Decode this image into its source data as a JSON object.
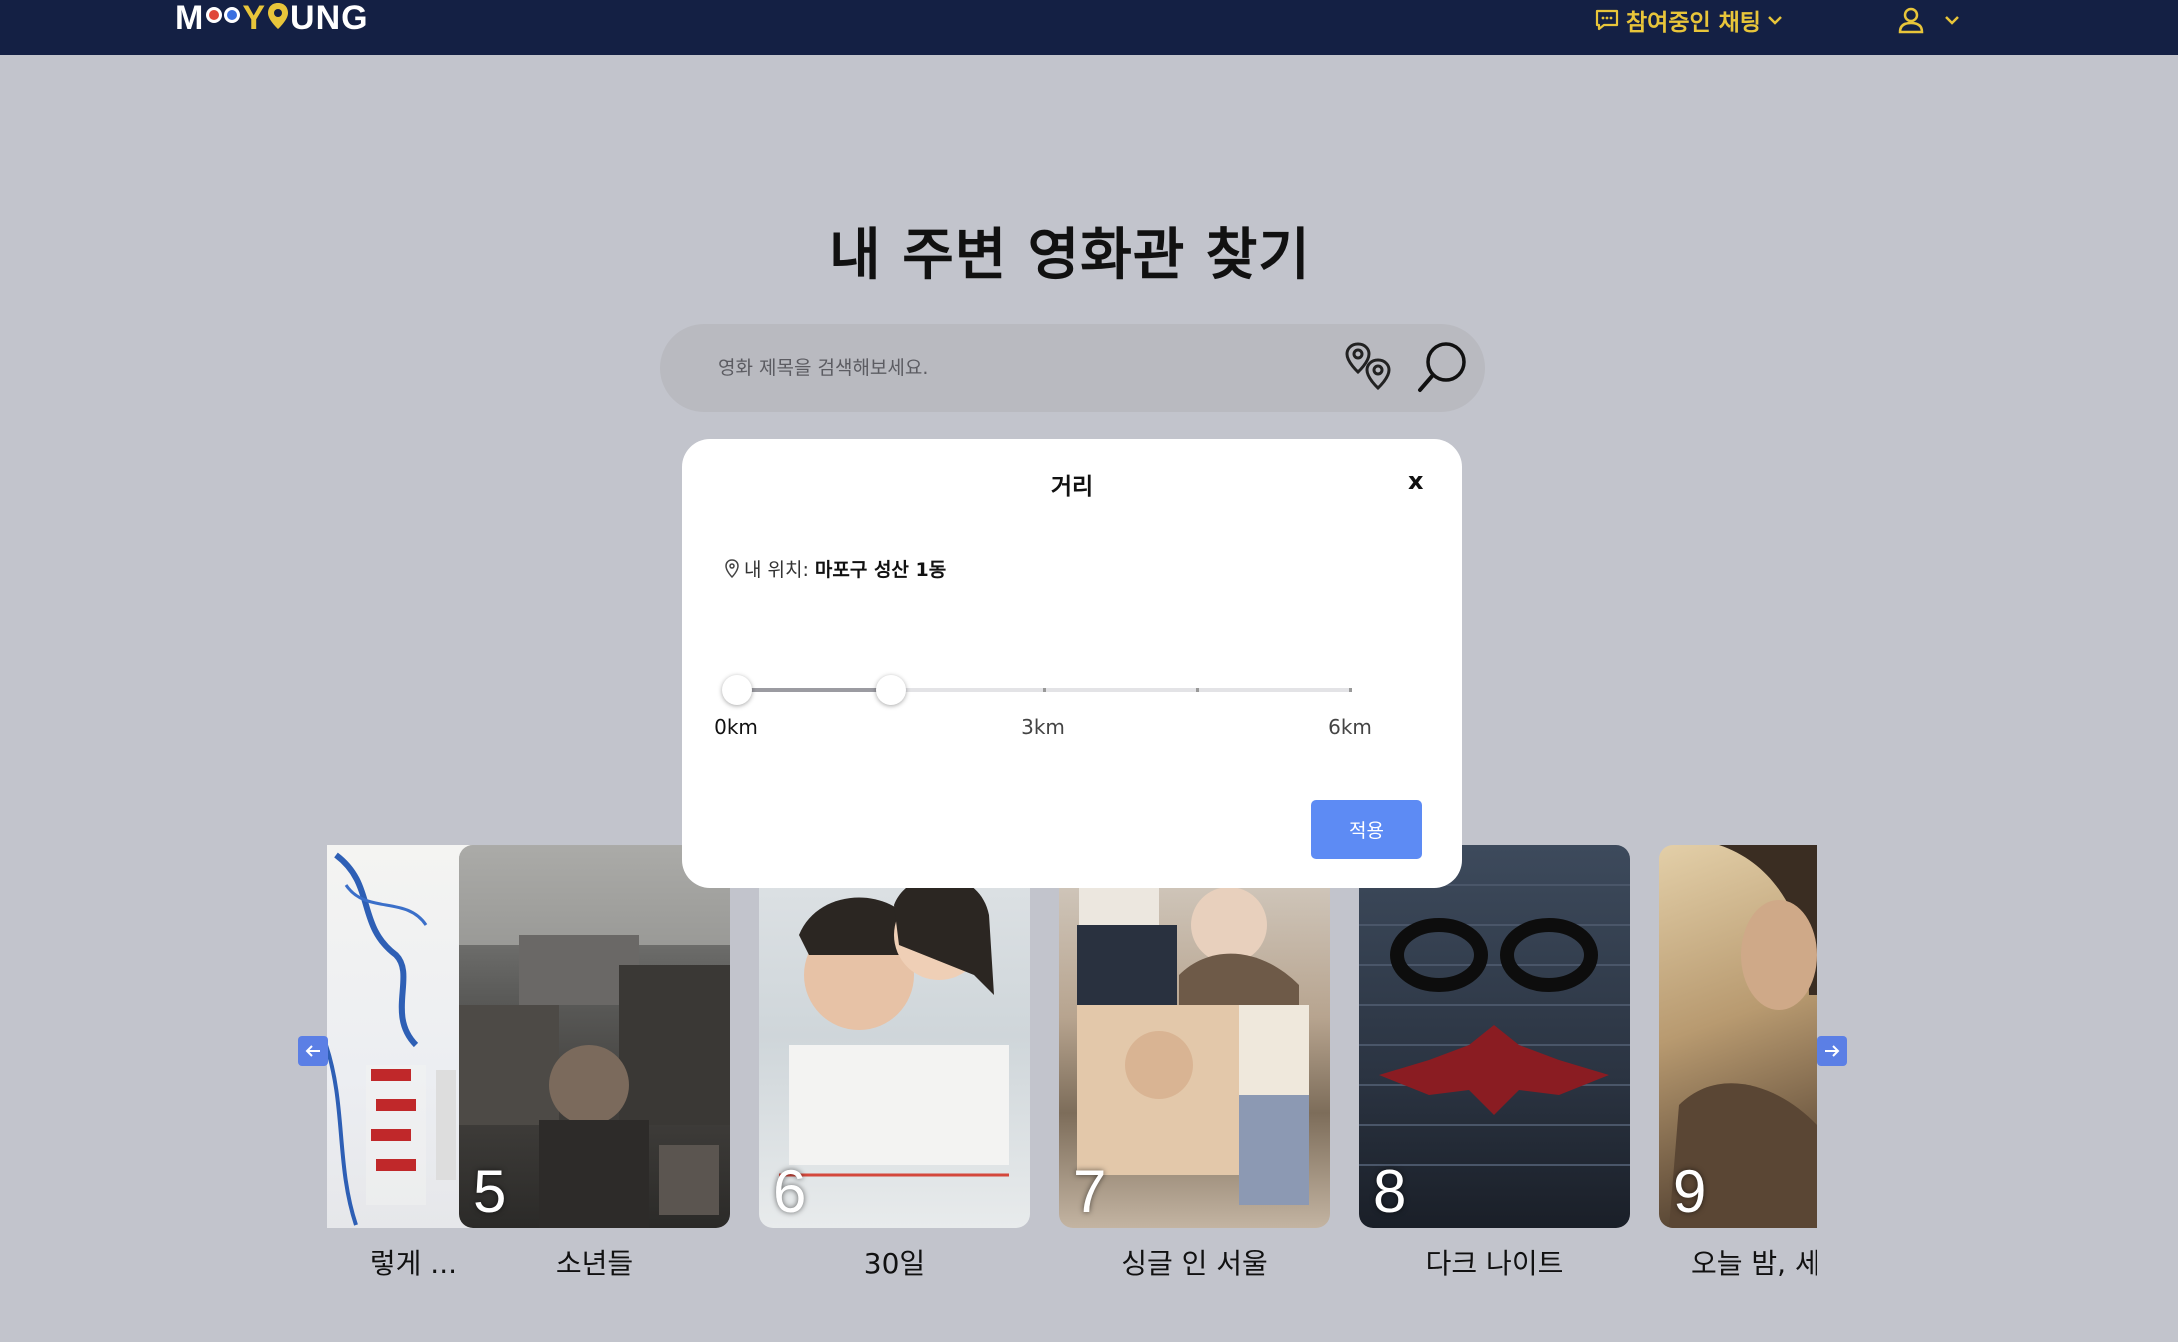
{
  "header": {
    "logo_prefix": "M",
    "logo_mid": "Y",
    "logo_suffix": "UNG",
    "chat_label": "참여중인 채팅",
    "chat_icon": "chat-bubble-icon",
    "user_icon": "user-icon",
    "accent": "#e8c53a",
    "bg": "#142044"
  },
  "main": {
    "title": "내 주변 영화관 찾기",
    "search_placeholder": "영화 제목을 검색해보세요.",
    "location_icon": "map-pins-icon",
    "search_icon": "search-icon"
  },
  "carousel": {
    "prev_icon": "arrow-left-icon",
    "next_icon": "arrow-right-icon",
    "movies": [
      {
        "rank": "",
        "title": "렇게 ..."
      },
      {
        "rank": "5",
        "title": "소년들"
      },
      {
        "rank": "6",
        "title": "30일"
      },
      {
        "rank": "7",
        "title": "싱글 인 서울"
      },
      {
        "rank": "8",
        "title": "다크 나이트"
      },
      {
        "rank": "9",
        "title": "오늘 밤, 세"
      }
    ]
  },
  "modal": {
    "title": "거리",
    "close_label": "x",
    "location_label": "내 위치:",
    "location_value": "마포구 성산 1동",
    "slider": {
      "value_km": 1.5,
      "min_km": 0,
      "max_km": 6,
      "ticks": [
        "0km",
        "3km",
        "6km"
      ]
    },
    "apply_label": "적용",
    "apply_color": "#5d8bf4"
  }
}
